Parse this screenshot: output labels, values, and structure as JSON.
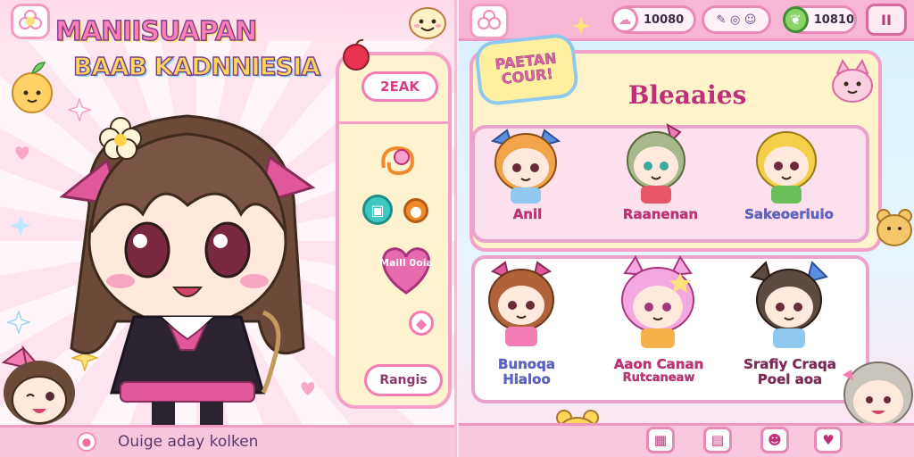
{
  "left": {
    "title_line1": "MANIISUAPAN",
    "title_line2": "BAAB KADNNIESIA",
    "menu": {
      "top_pill": "2EAK",
      "heart_label": "Maill 0oia",
      "bottom_pill": "Rangis"
    },
    "bottom_text": "Ouige aday kolken"
  },
  "right": {
    "resources": [
      {
        "icon": "cloud-icon",
        "value": "10080"
      },
      {
        "icon": "tools-icon",
        "value": ""
      },
      {
        "icon": "leaf-icon",
        "value": "10810"
      }
    ],
    "pause_label": "II",
    "badge_line1": "PAETAN",
    "badge_line2": "COUR!",
    "panel_title": "Bleaaies",
    "row1_names": [
      "Anil",
      "Raanenan",
      "Sakeoeriuio"
    ],
    "row2_names": [
      {
        "line1": "Bunoqa",
        "line2": "Hialoo"
      },
      {
        "line1": "Aaon Canan",
        "line2": "Rutcaneaw"
      },
      {
        "line1": "Srafiy Craqa",
        "line2": "Poel aoa"
      }
    ],
    "nav_icons": [
      "map-icon",
      "chest-icon",
      "pet-icon",
      "heart-icon"
    ]
  },
  "colors": {
    "accent_pink": "#f27cb3",
    "panel_yellow": "#fff4c9",
    "title_purple": "#7a3f8a"
  }
}
